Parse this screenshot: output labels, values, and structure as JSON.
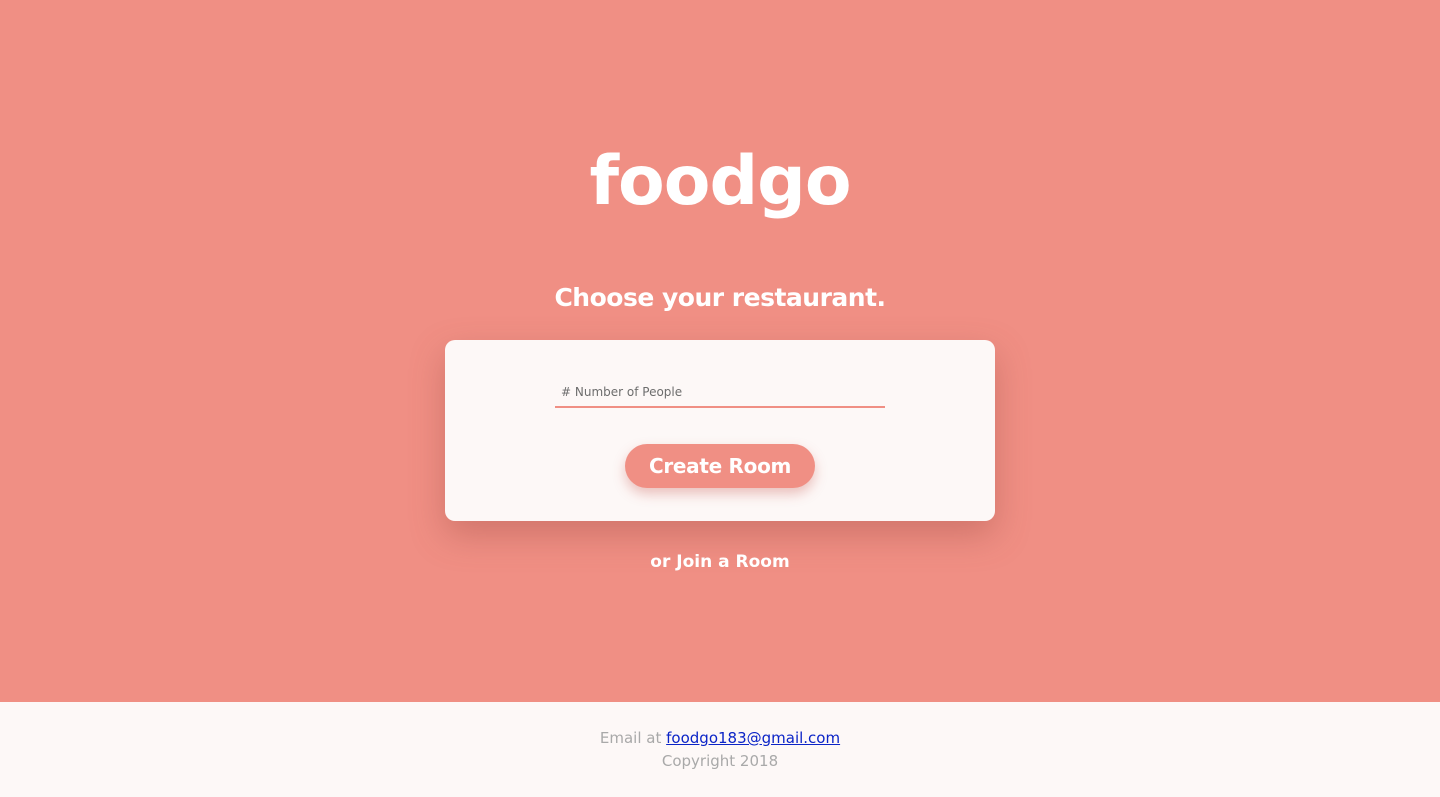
{
  "brand": {
    "logo_text": "foodgo"
  },
  "hero": {
    "tagline": "Choose your restaurant."
  },
  "card": {
    "people_input_placeholder": "# Number of People",
    "people_input_value": "",
    "create_button_label": "Create Room"
  },
  "join": {
    "link_label": "or Join a Room"
  },
  "footer": {
    "email_prefix": "Email at",
    "email": "foodgo183@gmail.com",
    "copyright": "Copyright 2018"
  },
  "colors": {
    "accent": "#f08f84",
    "background_light": "#fdf8f7",
    "link": "#0b24c7",
    "muted_text": "#a9a9a9"
  }
}
